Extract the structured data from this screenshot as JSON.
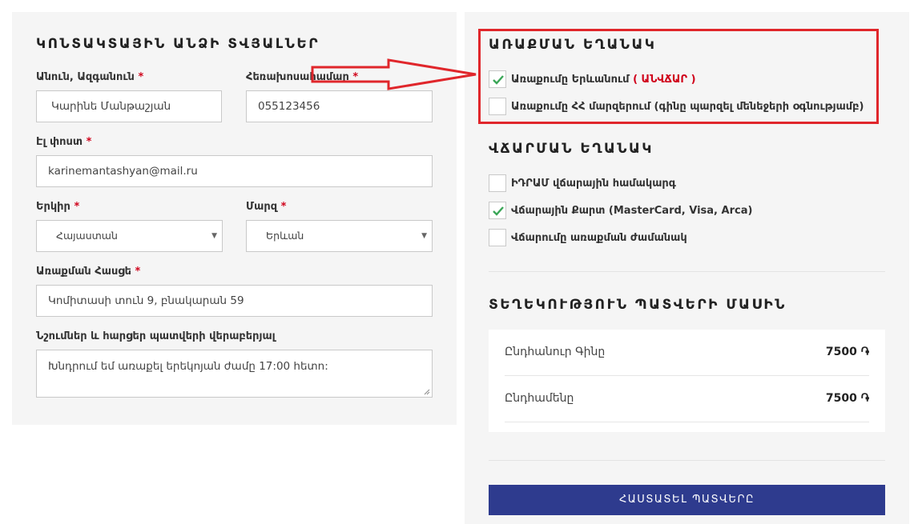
{
  "contact": {
    "title": "ԿՈՆՏԱԿՏԱՅԻՆ ԱՆՁԻ ՏՎՅԱԼՆԵՐ",
    "name_label": "Անուն, Ազգանուն",
    "name_value": "Կարինե Մանթաշյան",
    "phone_label": "Հեռախոսահամար",
    "phone_value": "055123456",
    "email_label": "Էլ փոստ",
    "email_value": "karinemantashyan@mail.ru",
    "country_label": "Երկիր",
    "country_value": "Հայաստան",
    "region_label": "Մարզ",
    "region_value": "Երևան",
    "address_label": "Առաքման Հասցե",
    "address_value": "Կոմիտասի տուն 9, բնակարան 59",
    "notes_label": "Նշումներ և հարցեր պատվերի վերաբերյալ",
    "notes_value": "Խնդրում եմ առաքել երեկոյան ժամը 17:00 հետո:",
    "required_mark": "*"
  },
  "delivery": {
    "title": "ԱՌԱՔՄԱՆ ԵՂԱՆԱԿ",
    "options": [
      {
        "label": "Առաքումը Երևանում",
        "free_label": "( ԱՆՎՃԱՐ )",
        "checked": true
      },
      {
        "label": "Առաքումը ՀՀ մարզերում (գինը պարզել մենեջերի օգնությամբ)",
        "checked": false
      }
    ]
  },
  "payment": {
    "title": "ՎՃԱՐՄԱՆ ԵՂԱՆԱԿ",
    "options": [
      {
        "label": "ԻԴՐԱՄ վճարային համակարգ",
        "checked": false
      },
      {
        "label": "Վճարային Քարտ (MasterCard, Visa, Arca)",
        "checked": true
      },
      {
        "label": "Վճարումը առաքման ժամանակ",
        "checked": false
      }
    ]
  },
  "order_info": {
    "title": "ՏԵՂԵԿՈՒԹՅՈՒՆ ՊԱՏՎԵՐԻ ՄԱՍԻՆ",
    "rows": [
      {
        "key": "Ընդհանուր Գինը",
        "value": "7500 ֏"
      },
      {
        "key": "Ընդհամենը",
        "value": "7500 ֏"
      }
    ]
  },
  "confirm_button": "ՀԱՍՏԱՏԵԼ ՊԱՏՎԵՐԸ",
  "colors": {
    "accent_button": "#2e3b8e",
    "highlight": "#e0262b",
    "check": "#3aa657",
    "required": "#d0021b"
  }
}
